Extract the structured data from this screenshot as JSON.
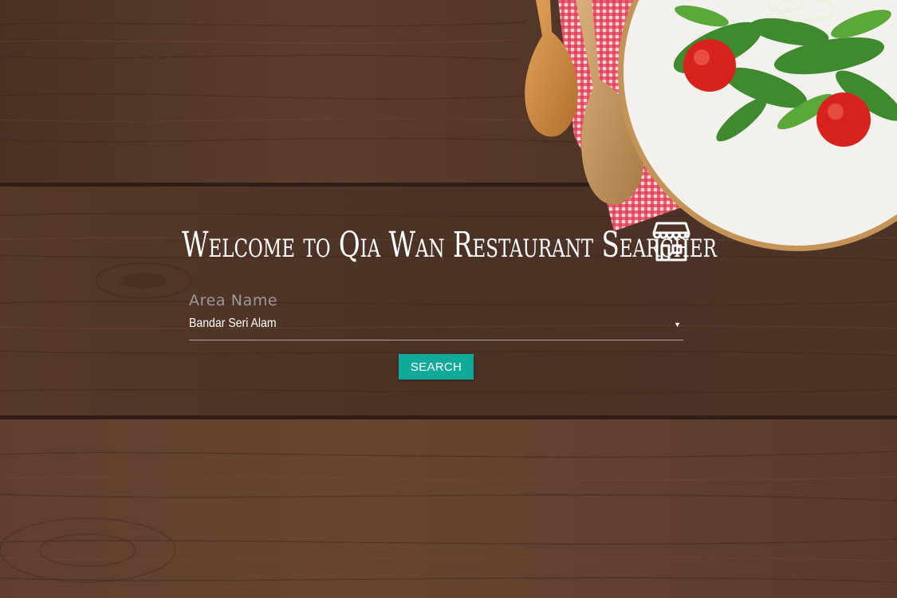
{
  "page": {
    "title": "Welcome to Qia Wan Restaurant Searcher",
    "title_icon": "store-icon"
  },
  "form": {
    "area_label": "Area Name",
    "area_selected": "Bandar Seri Alam",
    "search_label": "SEARCH"
  },
  "colors": {
    "button": "#11a99a",
    "title_text": "#ffffff",
    "label_text": "#9a9a9a"
  }
}
